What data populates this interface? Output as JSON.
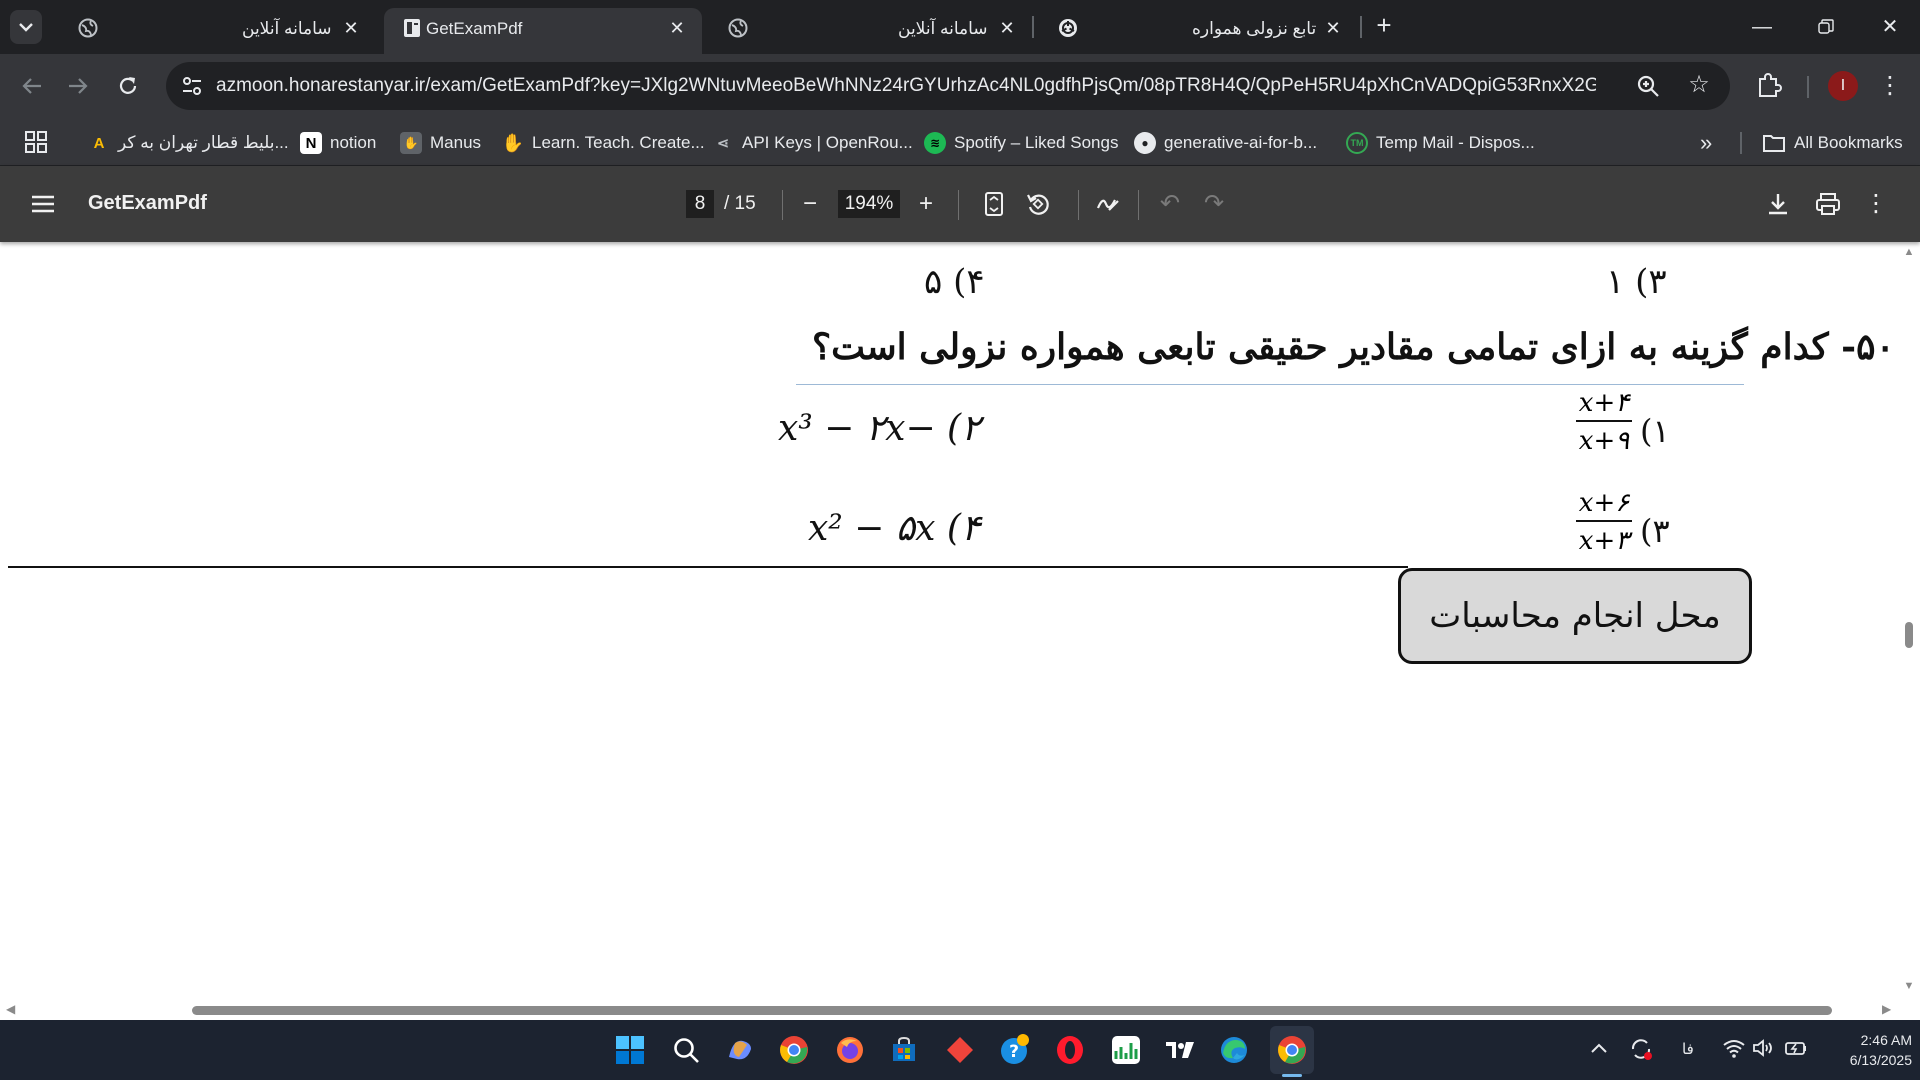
{
  "browser": {
    "tabs": [
      {
        "title": "سامانه آنلاین",
        "active": false,
        "favicon": "globe-icon"
      },
      {
        "title": "GetExamPdf",
        "active": true,
        "favicon": "document-icon"
      },
      {
        "title": "سامانه آنلاین",
        "active": false,
        "favicon": "globe-icon"
      },
      {
        "title": "تابع نزولی همواره",
        "active": false,
        "favicon": "openai-icon"
      }
    ],
    "url": "azmoon.honarestanyar.ir/exam/GetExamPdf?key=JXlg2WNtuvMeeoBeWhNNz24rGYUrhzAc4NL0gdfhPjsQm/08pTR8H4Q/QpPeH5RU4pXhCnVADQpiG53RnxX2GfVD...",
    "profile_initial": "I",
    "bookmarks": [
      {
        "label": "بلیط قطار تهران به کر...",
        "icon": "alibaba-icon"
      },
      {
        "label": "notion",
        "icon": "notion-icon"
      },
      {
        "label": "Manus",
        "icon": "manus-icon"
      },
      {
        "label": "Learn. Teach. Create...",
        "icon": "hand-icon"
      },
      {
        "label": "API Keys | OpenRou...",
        "icon": "openrouter-icon"
      },
      {
        "label": "Spotify – Liked Songs",
        "icon": "spotify-icon"
      },
      {
        "label": "generative-ai-for-b...",
        "icon": "github-icon"
      },
      {
        "label": "Temp Mail - Dispos...",
        "icon": "tempmail-icon"
      }
    ],
    "more_bookmarks": "»",
    "all_bookmarks": "All Bookmarks"
  },
  "pdf_viewer": {
    "title": "GetExamPdf",
    "current_page": "8",
    "total_pages": "/ 15",
    "zoom": "194%"
  },
  "document": {
    "prev_option_3": "۳) ۱",
    "prev_option_4": "۴) ۵",
    "question": "۵۰- کدام گزینه به ازای تمامی مقادیر حقیقی تابعی همواره نزولی است؟",
    "opt1_label": "۱)",
    "opt1_num": "x+۴",
    "opt1_den": "x+۹",
    "opt2": "۲) −x³ − ۲x",
    "opt3_label": "۳)",
    "opt3_num": "x+۶",
    "opt3_den": "x+۳",
    "opt4": "۴) x² − ۵x",
    "calc_area": "محل انجام محاسبات"
  },
  "taskbar": {
    "language": "فا",
    "time": "2:46 AM",
    "date": "6/13/2025"
  },
  "colors": {
    "tab_bg": "#202124",
    "toolbar_bg": "#35363a",
    "pdf_toolbar_bg": "#3c3c3c",
    "taskbar_bg": "#1c2330",
    "calc_box_bg": "#d9d9d9"
  }
}
